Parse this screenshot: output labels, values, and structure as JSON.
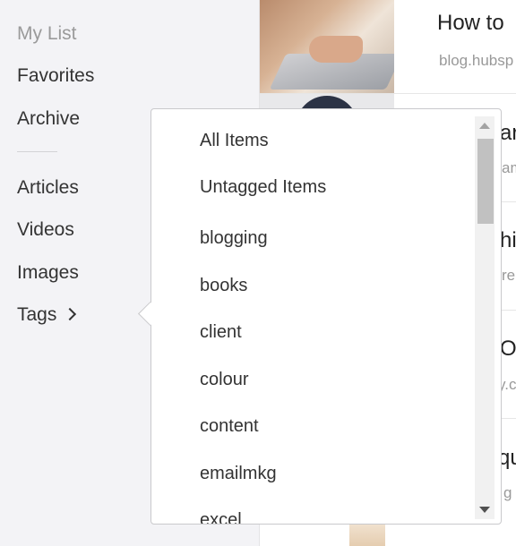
{
  "sidebar": {
    "items": [
      {
        "label": "My List"
      },
      {
        "label": "Favorites"
      },
      {
        "label": "Archive"
      },
      {
        "label": "Articles"
      },
      {
        "label": "Videos"
      },
      {
        "label": "Images"
      },
      {
        "label": "Tags"
      }
    ]
  },
  "articles": [
    {
      "title": "How to",
      "domain": "blog.hubsp"
    },
    {
      "title": "ar",
      "domain": "am"
    },
    {
      "title": "hi",
      "domain": "re"
    },
    {
      "title": "O",
      "domain": "y.c"
    },
    {
      "title": "qu",
      "domain": "g"
    }
  ],
  "tags_dropdown": {
    "items": [
      {
        "label": "All Items"
      },
      {
        "label": "Untagged Items"
      },
      {
        "label": "blogging"
      },
      {
        "label": "books"
      },
      {
        "label": "client"
      },
      {
        "label": "colour"
      },
      {
        "label": "content"
      },
      {
        "label": "emailmkg"
      },
      {
        "label": "excel"
      }
    ]
  },
  "icons": {
    "tags_chevron": "chevron-right-icon",
    "scroll_up": "triangle-up-icon",
    "scroll_down": "triangle-down-icon"
  }
}
